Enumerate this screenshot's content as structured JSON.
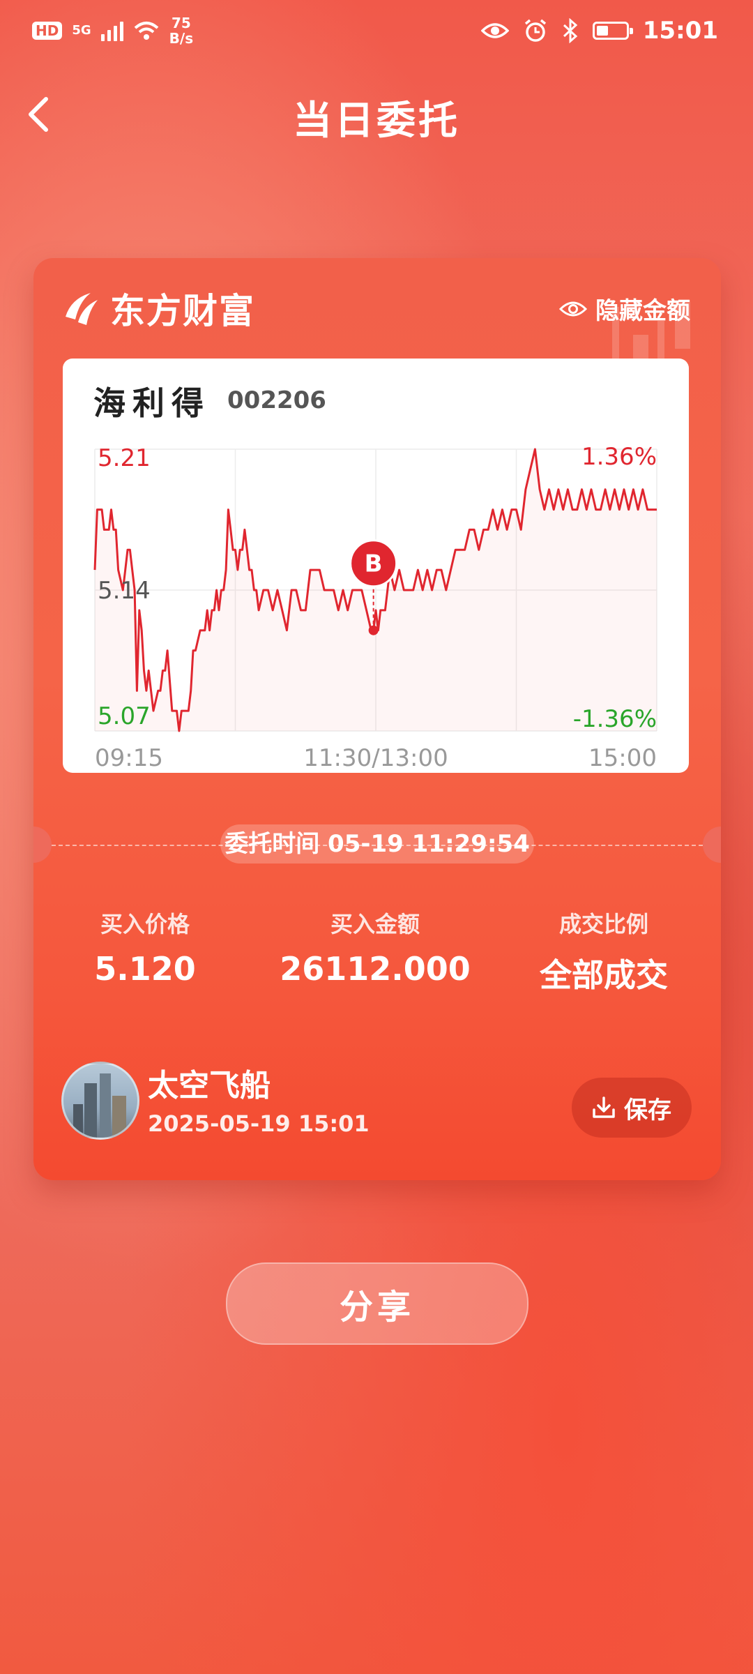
{
  "status_bar": {
    "hd": "HD",
    "network": "5G",
    "speed_value": "75",
    "speed_unit": "B/s",
    "time": "15:01",
    "battery_level": 0.4
  },
  "header": {
    "title": "当日委托"
  },
  "card": {
    "brand": "东方财富",
    "hide_amount_label": "隐藏金额",
    "stock_name": "海利得",
    "stock_code": "002206",
    "buy_marker": "B",
    "order_time": "委托时间 05-19 11:29:54",
    "stats": [
      {
        "label": "买入价格",
        "value": "5.120"
      },
      {
        "label": "买入金额",
        "value": "26112.000"
      },
      {
        "label": "成交比例",
        "value": "全部成交"
      }
    ],
    "user": {
      "name": "太空飞船",
      "datetime": "2025-05-19 15:01"
    },
    "save_label": "保存"
  },
  "share_label": "分享",
  "chart_data": {
    "type": "line",
    "ylim": [
      5.07,
      5.21
    ],
    "y_ticks": [
      "5.21",
      "5.14",
      "5.07"
    ],
    "pct_ticks": [
      "1.36%",
      "-1.36%"
    ],
    "x_ticks": [
      "09:15",
      "11:30/13:00",
      "15:00"
    ],
    "x_range": [
      0,
      240
    ],
    "buy_point": {
      "x": 119,
      "y": 5.12,
      "label": "B"
    },
    "series": [
      {
        "x": [
          0,
          1,
          3,
          4,
          5,
          6,
          7,
          8,
          9,
          10,
          12,
          13,
          14,
          15,
          16,
          17,
          18,
          19,
          20,
          21,
          22,
          23,
          24,
          25,
          27,
          28,
          29,
          30,
          31,
          33,
          35,
          36,
          37,
          38,
          40,
          41,
          42,
          43,
          45,
          46,
          47,
          48,
          49,
          50,
          51,
          52,
          53,
          54,
          55,
          56,
          57,
          58,
          59,
          60,
          61,
          62,
          63,
          64,
          65,
          66,
          67,
          68,
          69,
          70,
          72,
          74,
          76,
          78,
          80,
          82,
          84,
          86,
          88,
          90,
          92,
          94,
          96,
          98,
          100,
          102,
          104,
          106,
          108,
          110,
          112,
          114,
          116,
          118,
          119,
          120,
          121,
          122,
          124,
          126,
          128,
          130,
          132,
          134,
          136,
          138,
          140,
          142,
          144,
          146,
          148,
          150,
          152,
          154,
          156,
          158,
          160,
          162,
          164,
          166,
          168,
          170,
          172,
          174,
          176,
          178,
          180,
          182,
          184,
          186,
          188,
          190,
          192,
          194,
          196,
          198,
          200,
          202,
          204,
          206,
          208,
          210,
          212,
          214,
          216,
          218,
          220,
          222,
          224,
          226,
          228,
          230,
          232,
          234,
          236,
          238,
          240
        ],
        "values": [
          5.15,
          5.18,
          5.18,
          5.17,
          5.17,
          5.17,
          5.18,
          5.17,
          5.17,
          5.15,
          5.14,
          5.15,
          5.16,
          5.16,
          5.15,
          5.14,
          5.09,
          5.13,
          5.12,
          5.1,
          5.09,
          5.1,
          5.09,
          5.08,
          5.09,
          5.09,
          5.1,
          5.1,
          5.11,
          5.08,
          5.08,
          5.07,
          5.08,
          5.08,
          5.08,
          5.09,
          5.11,
          5.11,
          5.12,
          5.12,
          5.12,
          5.13,
          5.12,
          5.13,
          5.13,
          5.14,
          5.13,
          5.14,
          5.14,
          5.15,
          5.18,
          5.17,
          5.16,
          5.16,
          5.15,
          5.16,
          5.16,
          5.17,
          5.16,
          5.15,
          5.15,
          5.14,
          5.14,
          5.13,
          5.14,
          5.14,
          5.13,
          5.14,
          5.13,
          5.12,
          5.14,
          5.14,
          5.13,
          5.13,
          5.15,
          5.15,
          5.15,
          5.14,
          5.14,
          5.14,
          5.13,
          5.14,
          5.13,
          5.14,
          5.14,
          5.14,
          5.13,
          5.12,
          5.12,
          5.13,
          5.12,
          5.13,
          5.13,
          5.15,
          5.14,
          5.15,
          5.14,
          5.14,
          5.14,
          5.15,
          5.14,
          5.15,
          5.14,
          5.15,
          5.15,
          5.14,
          5.15,
          5.16,
          5.16,
          5.16,
          5.17,
          5.17,
          5.16,
          5.17,
          5.17,
          5.18,
          5.17,
          5.18,
          5.17,
          5.18,
          5.18,
          5.17,
          5.19,
          5.2,
          5.21,
          5.19,
          5.18,
          5.19,
          5.18,
          5.19,
          5.18,
          5.19,
          5.18,
          5.18,
          5.19,
          5.18,
          5.19,
          5.18,
          5.18,
          5.19,
          5.18,
          5.19,
          5.18,
          5.19,
          5.18,
          5.19,
          5.18,
          5.19,
          5.18,
          5.18,
          5.18
        ]
      }
    ]
  }
}
